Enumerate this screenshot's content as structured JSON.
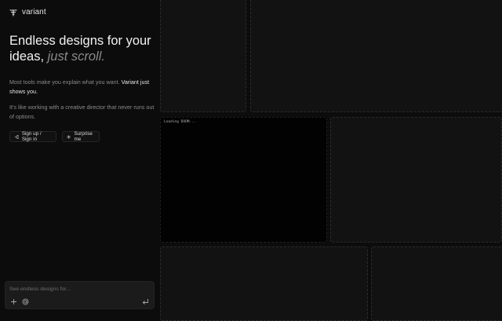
{
  "brand": {
    "name": "variant"
  },
  "hero": {
    "headline_main": "Endless designs for your ideas,",
    "headline_muted": "just scroll.",
    "desc1_plain": "Most tools make you explain what you want.",
    "desc1_highlight": "Variant just shows you.",
    "desc2": "It's like working with a creative director that never runs out of options."
  },
  "actions": {
    "signin_label": "Sign up / Sign in",
    "surprise_label": "Surprise me"
  },
  "prompt": {
    "placeholder": "See endless designs for..."
  },
  "canvas": {
    "loading_text": "Loading DOOM..."
  }
}
